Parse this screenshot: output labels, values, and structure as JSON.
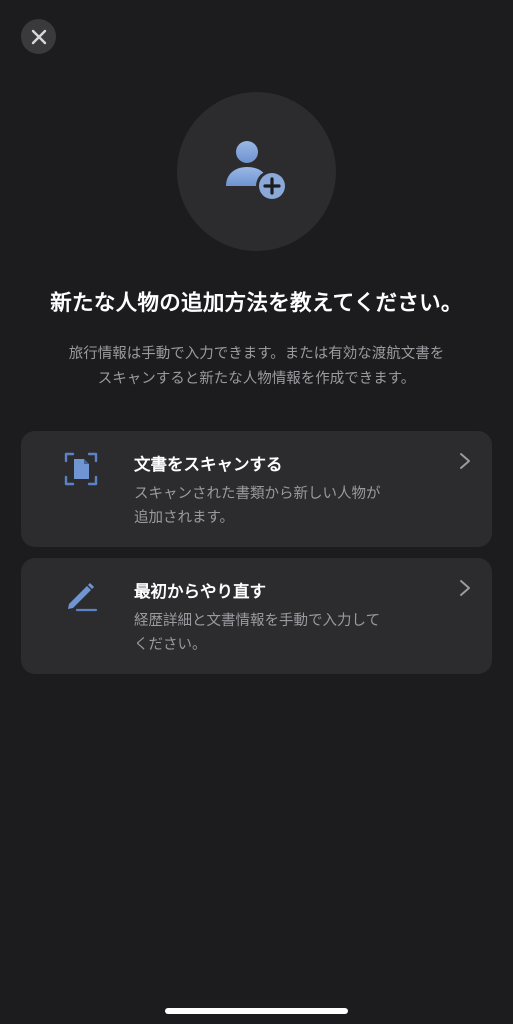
{
  "header": {
    "close_icon": "close-icon"
  },
  "hero": {
    "icon": "add-person-icon",
    "accent_color": "#8aa9d9"
  },
  "main": {
    "title": "新たな人物の追加方法を教えてください。",
    "description_line1": "旅行情報は手動で入力できます。または有効な渡航文書を",
    "description_line2": "スキャンすると新たな人物情報を作成できます。"
  },
  "options": [
    {
      "icon": "document-scan-icon",
      "title": "文書をスキャンする",
      "subtitle_line1": "スキャンされた書類から新しい人物が",
      "subtitle_line2": "追加されます。"
    },
    {
      "icon": "pencil-icon",
      "title": "最初からやり直す",
      "subtitle_line1": "経歴詳細と文書情報を手動で入力して",
      "subtitle_line2": "ください。"
    }
  ],
  "colors": {
    "background": "#1c1c1e",
    "card": "#2c2c2e",
    "secondary_text": "#9a9aa0",
    "icon_blue": "#5b82c4"
  }
}
